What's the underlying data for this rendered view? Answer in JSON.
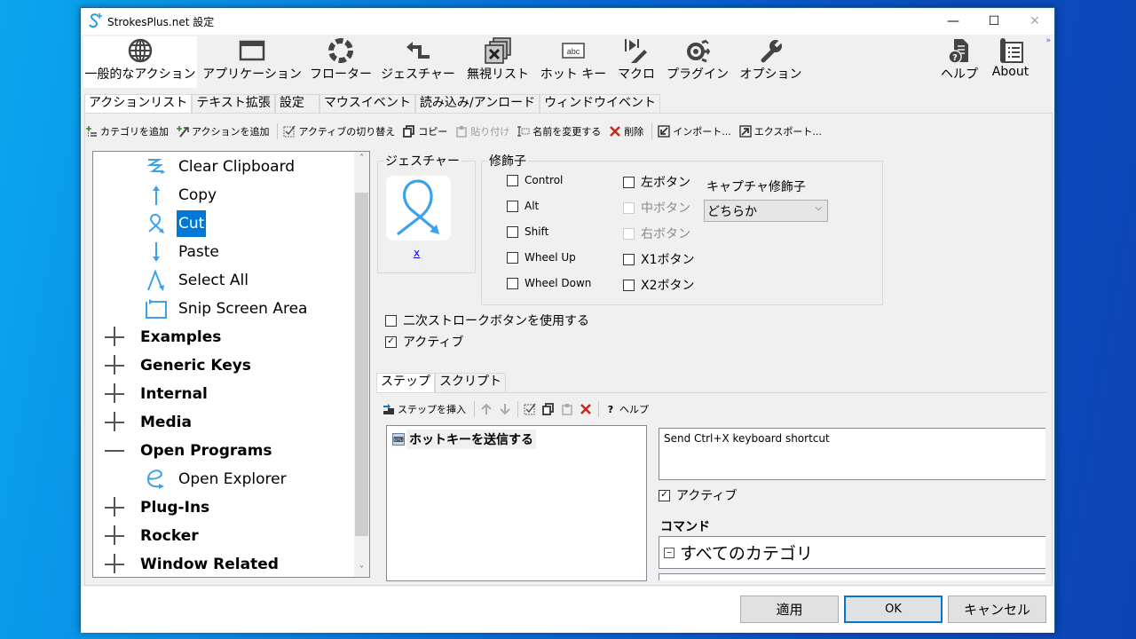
{
  "window": {
    "title": "StrokesPlus.net 設定",
    "app_icon": "S+",
    "minimize": "—",
    "maximize": "☐",
    "close": "✕"
  },
  "ribbon": {
    "items": [
      {
        "label": "一般的なアクション",
        "icon": "globe-icon",
        "active": true
      },
      {
        "label": "アプリケーション",
        "icon": "window-icon"
      },
      {
        "label": "フローター",
        "icon": "floater-ring-icon"
      },
      {
        "label": "ジェスチャー",
        "icon": "gesture-arrow-icon"
      },
      {
        "label": "無視リスト",
        "icon": "ignore-list-icon"
      },
      {
        "label": "ホット キー",
        "icon": "hotkey-abc-icon"
      },
      {
        "label": "マクロ",
        "icon": "macro-icon"
      },
      {
        "label": "プラグイン",
        "icon": "plugin-icon"
      },
      {
        "label": "オプション",
        "icon": "wrench-icon"
      },
      {
        "label": "ヘルプ",
        "icon": "help-doc-icon"
      },
      {
        "label": "About",
        "icon": "about-icon"
      }
    ],
    "overflow": "»"
  },
  "main_tabs": [
    "アクションリスト",
    "テキスト拡張",
    "設定",
    "マウスイベント",
    "読み込み/アンロード",
    "ウィンドウイベント"
  ],
  "toolbar": {
    "add_category": "カテゴリを追加",
    "add_action": "アクションを追加",
    "toggle_active": "アクティブの切り替え",
    "copy": "コピー",
    "paste": "貼り付け",
    "rename": "名前を変更する",
    "delete": "削除",
    "import": "インポート...",
    "export": "エクスポート..."
  },
  "tree": {
    "actions": [
      {
        "label": "Clear Clipboard"
      },
      {
        "label": "Copy"
      },
      {
        "label": "Cut",
        "selected": true
      },
      {
        "label": "Paste"
      },
      {
        "label": "Select All"
      },
      {
        "label": "Snip Screen Area"
      }
    ],
    "categories_before": [
      {
        "label": "Examples",
        "expanded": false
      },
      {
        "label": "Generic Keys",
        "expanded": false
      },
      {
        "label": "Internal",
        "expanded": false
      },
      {
        "label": "Media",
        "expanded": false
      },
      {
        "label": "Open Programs",
        "expanded": true
      }
    ],
    "open_programs_children": [
      {
        "label": "Open Explorer"
      }
    ],
    "categories_after": [
      {
        "label": "Plug-Ins",
        "expanded": false
      },
      {
        "label": "Rocker",
        "expanded": false
      },
      {
        "label": "Window Related",
        "expanded": false
      }
    ]
  },
  "gesture": {
    "group_title": "ジェスチャー",
    "name": "x"
  },
  "modifiers": {
    "group_title": "修飾子",
    "left_col": [
      {
        "label": "Control",
        "checked": false
      },
      {
        "label": "Alt",
        "checked": false
      },
      {
        "label": "Shift",
        "checked": false
      },
      {
        "label": "Wheel Up",
        "checked": false
      },
      {
        "label": "Wheel Down",
        "checked": false
      }
    ],
    "right_col": [
      {
        "label": "左ボタン",
        "checked": false,
        "disabled": false
      },
      {
        "label": "中ボタン",
        "checked": false,
        "disabled": true
      },
      {
        "label": "右ボタン",
        "checked": false,
        "disabled": true
      },
      {
        "label": "X1ボタン",
        "checked": false,
        "disabled": false
      },
      {
        "label": "X2ボタン",
        "checked": false,
        "disabled": false
      }
    ],
    "capture_label": "キャプチャ修飾子",
    "capture_value": "どちらか"
  },
  "options": {
    "secondary_stroke": {
      "label": "二次ストロークボタンを使用する",
      "checked": false
    },
    "active": {
      "label": "アクティブ",
      "checked": true
    }
  },
  "step_tabs": [
    "ステップ",
    "スクリプト"
  ],
  "step_toolbar": {
    "insert": "ステップを挿入",
    "help": "ヘルプ"
  },
  "steps": [
    {
      "label": "ホットキーを送信する"
    }
  ],
  "step_detail": {
    "description": "Send Ctrl+X keyboard shortcut",
    "active_label": "アクティブ",
    "active_checked": true,
    "command_label": "コマンド",
    "command_value": "すべてのカテゴリ"
  },
  "footer": {
    "apply": "適用",
    "ok": "OK",
    "cancel": "キャンセル"
  },
  "colors": {
    "selection": "#0078d7",
    "gesture_stroke": "#3ba3ec",
    "delete_red": "#c42b1c"
  }
}
